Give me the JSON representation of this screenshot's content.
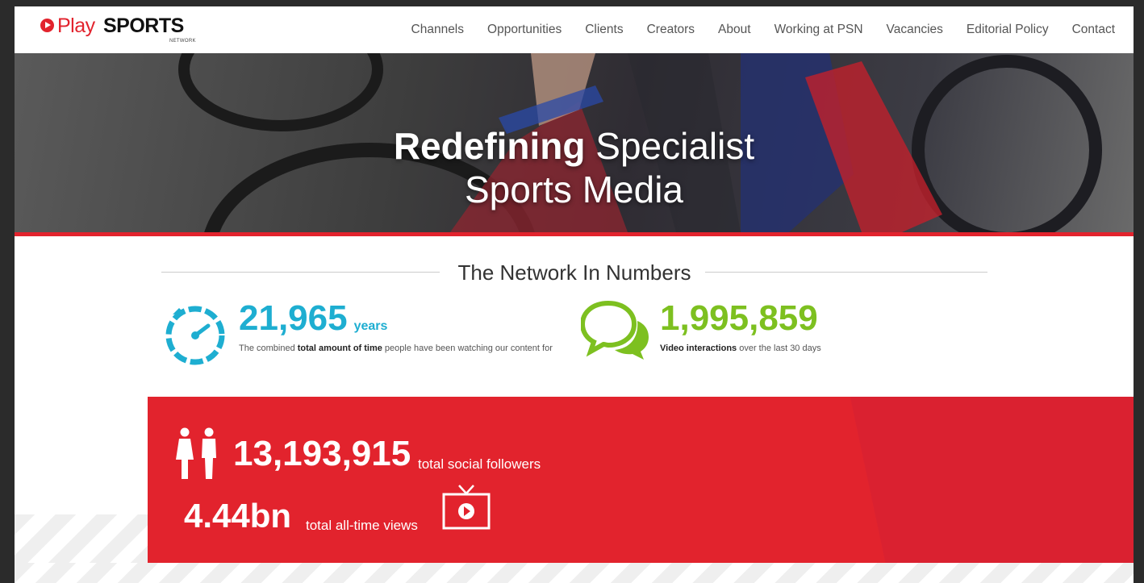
{
  "brand": {
    "play": "Play",
    "sports": "SPORTS",
    "network": "NETWORK",
    "accent": "#e2232d"
  },
  "nav": {
    "items": [
      "Channels",
      "Opportunities",
      "Clients",
      "Creators",
      "About",
      "Working at PSN",
      "Vacancies",
      "Editorial Policy",
      "Contact"
    ]
  },
  "hero": {
    "title_bold": "Redefining",
    "title_light_1": "Specialist",
    "title_light_2": "Sports Media"
  },
  "numbers": {
    "section_title": "The Network In Numbers",
    "time": {
      "icon": "stopwatch-icon",
      "value": "21,965",
      "unit": "years",
      "desc_pre": "The combined ",
      "desc_bold": "total amount of time",
      "desc_post": " people have been watching our content for",
      "color": "#1eaed1"
    },
    "interactions": {
      "icon": "speech-bubbles-icon",
      "value": "1,995,859",
      "desc_bold": "Video interactions",
      "desc_post": " over the last 30 days",
      "color": "#7dc020"
    }
  },
  "band": {
    "followers_icon": "people-icon",
    "followers_value": "13,193,915",
    "followers_label": "total social followers",
    "views_value": "4.44bn",
    "views_label": "total all-time views",
    "views_icon": "tv-play-icon",
    "color": "#e2232d"
  }
}
